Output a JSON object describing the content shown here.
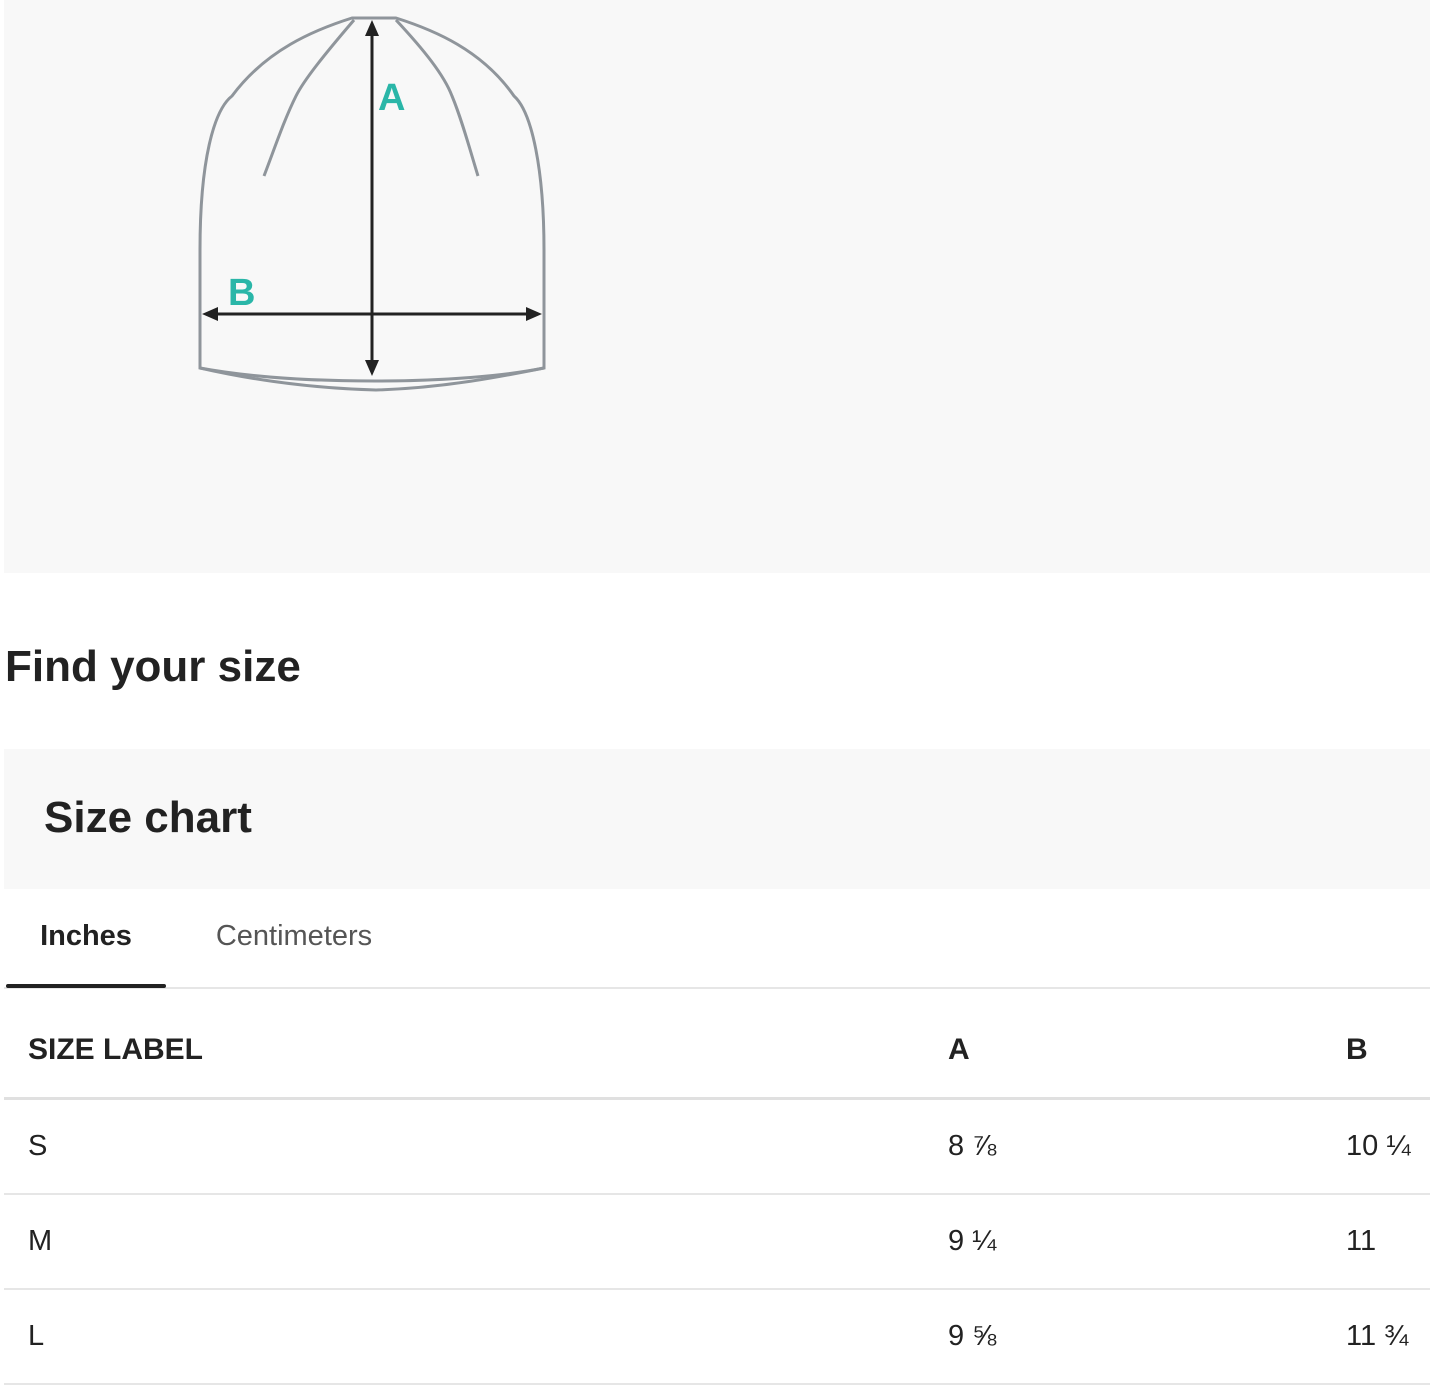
{
  "diagram": {
    "label_a": "A",
    "label_b": "B",
    "accent_color": "#2ab6a8",
    "outline_color": "#8f959b",
    "arrow_color": "#222222"
  },
  "page": {
    "find_size_title": "Find your size"
  },
  "size_chart": {
    "title": "Size chart",
    "tabs": [
      {
        "label": "Inches",
        "active": true
      },
      {
        "label": "Centimeters",
        "active": false
      }
    ],
    "columns": [
      "SIZE LABEL",
      "A",
      "B"
    ],
    "rows": [
      {
        "size": "S",
        "a": "8 ⅞",
        "b": "10 ¼"
      },
      {
        "size": "M",
        "a": "9 ¼",
        "b": "11"
      },
      {
        "size": "L",
        "a": "9 ⅝",
        "b": "11 ¾"
      }
    ]
  }
}
